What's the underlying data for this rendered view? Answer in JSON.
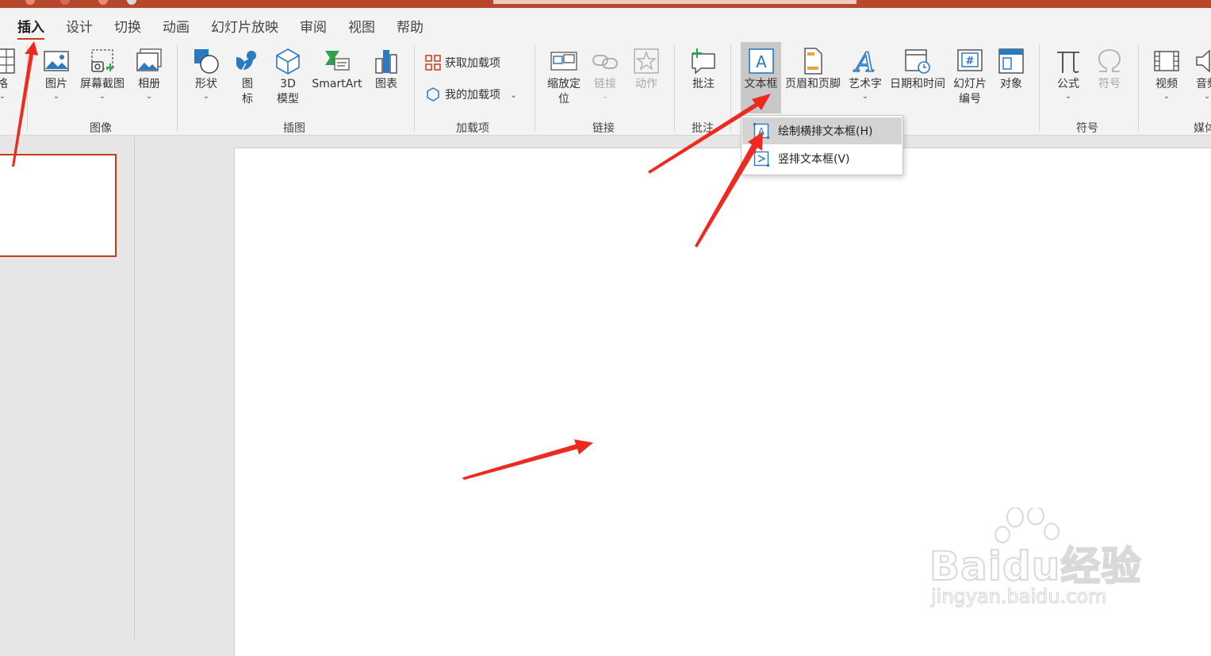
{
  "tabs": [
    {
      "label": "插入",
      "active": true
    },
    {
      "label": "设计"
    },
    {
      "label": "切换"
    },
    {
      "label": "动画"
    },
    {
      "label": "幻灯片放映"
    },
    {
      "label": "审阅"
    },
    {
      "label": "视图"
    },
    {
      "label": "帮助"
    }
  ],
  "ribbon": {
    "table_cut_label": "格",
    "image_group": {
      "label": "图像",
      "pictures": "图片",
      "screenshot": "屏幕截图",
      "album": "相册"
    },
    "illustrations_group": {
      "label": "插图",
      "shapes": "形状",
      "icons": "图\n标",
      "model3d": "3D\n模型",
      "smartart": "SmartArt",
      "chart": "图表"
    },
    "addins_group": {
      "label": "加载项",
      "get_addins": "获取加载项",
      "my_addins": "我的加载项"
    },
    "links_group": {
      "label": "链接",
      "zoom": "缩放定\n位",
      "link": "链接",
      "action": "动作"
    },
    "comments_group": {
      "label": "批注",
      "comment": "批注"
    },
    "text_group": {
      "textbox": "文本框",
      "header_footer": "页眉和页脚",
      "wordart": "艺术字",
      "datetime": "日期和时间",
      "slide_number": "幻灯片\n编号",
      "object": "对象"
    },
    "symbols_group": {
      "label": "符号",
      "equation": "公式",
      "symbol": "符号"
    },
    "media_group": {
      "label": "媒体",
      "video": "视频",
      "audio": "音频"
    }
  },
  "textbox_menu": {
    "horizontal": "绘制横排文本框(H)",
    "vertical": "竖排文本框(V)"
  },
  "watermark": {
    "logo": "Baidu经验",
    "url": "jingyan.baidu.com"
  },
  "colors": {
    "accent": "#c43e1c",
    "titlebar": "#b7472a",
    "annotation_arrow": "#ee2a1f",
    "icon_blue": "#2b79c2"
  }
}
